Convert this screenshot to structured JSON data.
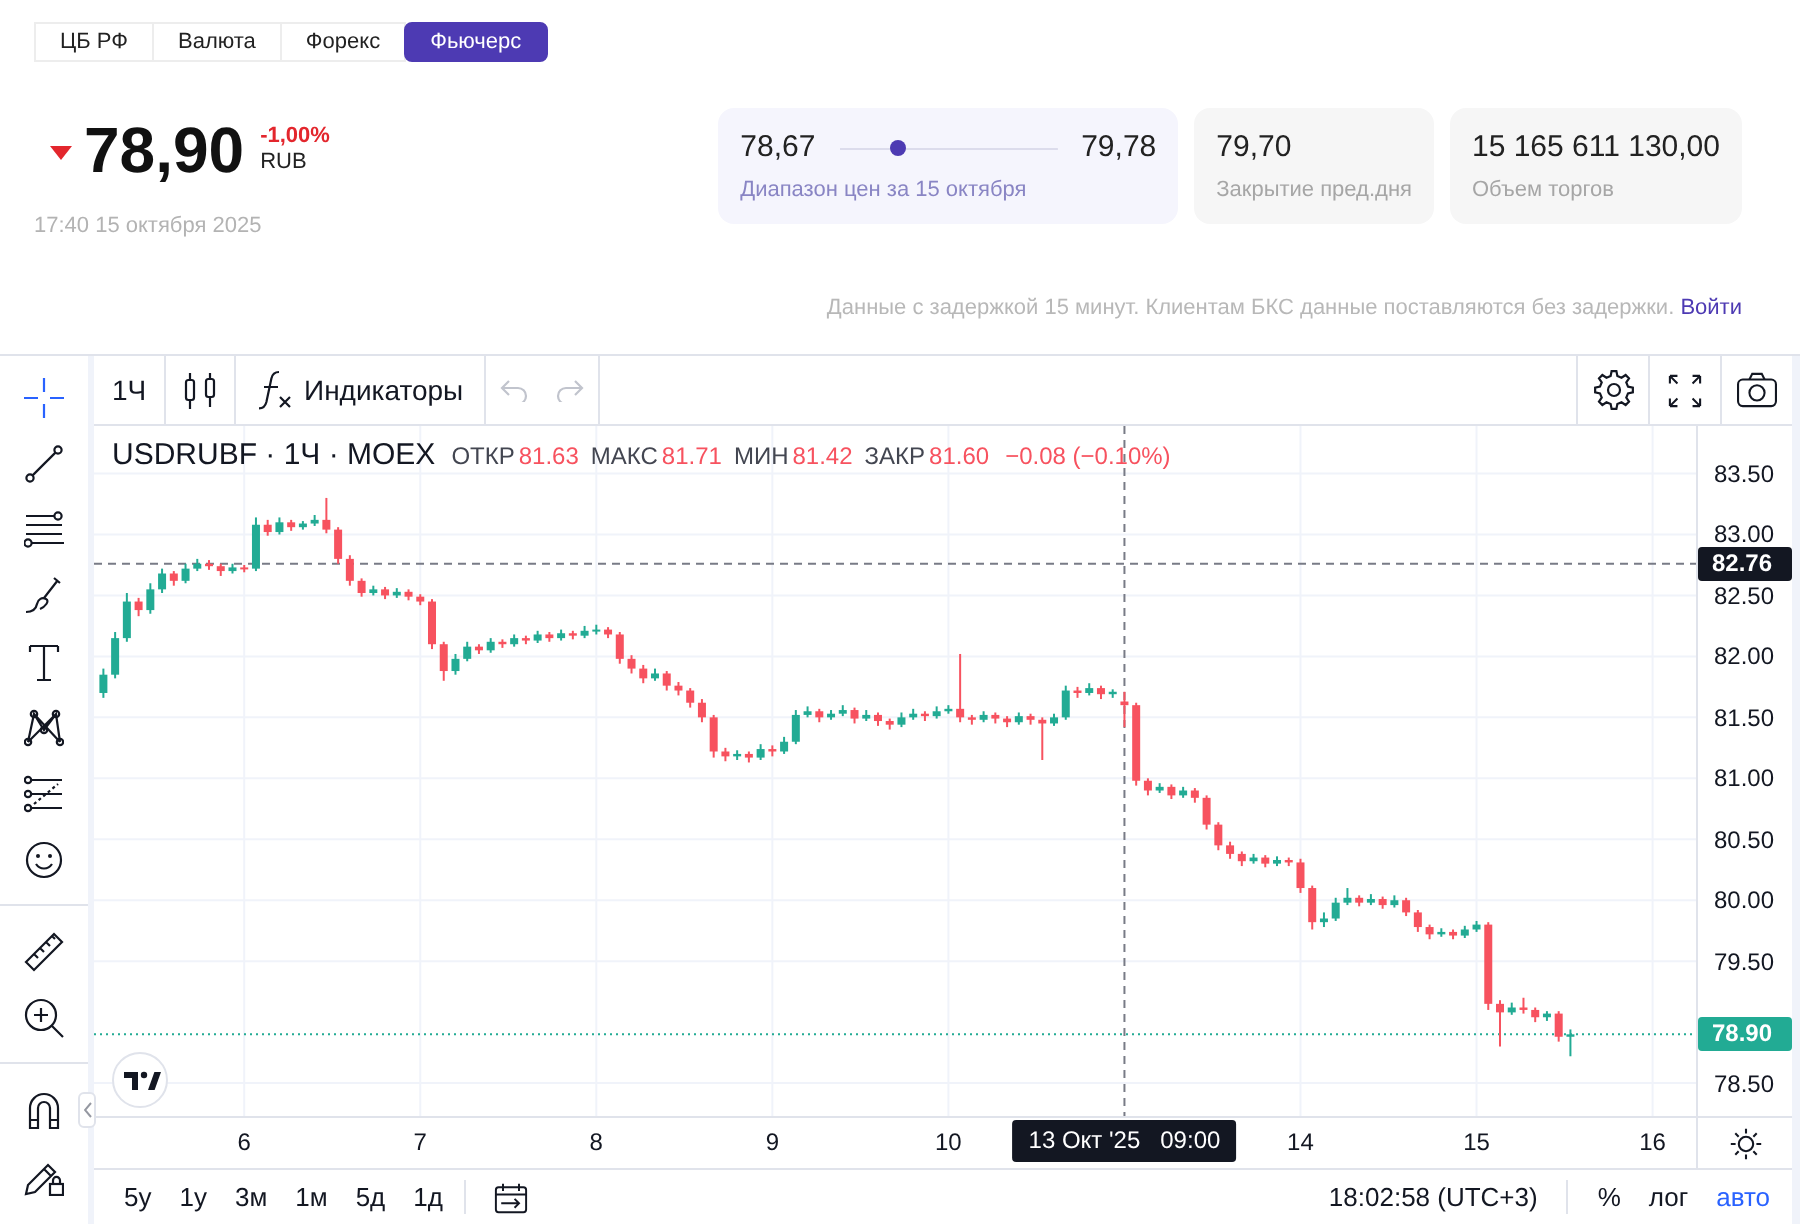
{
  "market_tabs": [
    {
      "label": "ЦБ РФ",
      "selected": false
    },
    {
      "label": "Валюта",
      "selected": false
    },
    {
      "label": "Форекс",
      "selected": false
    },
    {
      "label": "Фьючерс",
      "selected": true
    }
  ],
  "quote": {
    "falling": true,
    "price": "78,90",
    "change": "-1,00%",
    "currency": "RUB",
    "timestamp": "17:40 15 октября 2025"
  },
  "stats": [
    {
      "kind": "range",
      "low": "78,67",
      "high": "79,78",
      "level": 0.25,
      "label": "Диапазон цен за 15 октября"
    },
    {
      "kind": "value",
      "value": "79,70",
      "label": "Закрытие пред.дня"
    },
    {
      "kind": "value",
      "value": "15 165 611 130,00",
      "label": "Объем торгов"
    }
  ],
  "notice": {
    "text": "Данные с задержкой 15 минут. Клиентам БКС данные поставляются без задержки.",
    "link": "Войти"
  },
  "chart": {
    "drawing_tools": [
      {
        "tools": [
          {
            "kind": "crosshair",
            "selected": true
          },
          {
            "kind": "trend_line",
            "selected": false
          },
          {
            "kind": "parallel_lines",
            "selected": false
          },
          {
            "kind": "brush",
            "selected": false
          },
          {
            "kind": "text",
            "selected": false
          },
          {
            "kind": "pattern",
            "selected": false
          },
          {
            "kind": "projection",
            "selected": false
          },
          {
            "kind": "emoji",
            "selected": false
          }
        ]
      },
      {
        "tools": [
          {
            "kind": "ruler",
            "selected": false
          },
          {
            "kind": "zoom",
            "selected": false
          }
        ]
      },
      {
        "tools": [
          {
            "kind": "magnet",
            "selected": false
          },
          {
            "kind": "lock",
            "selected": false
          }
        ]
      }
    ],
    "toolbar": {
      "interval": "1Ч",
      "indicators": "Индикаторы",
      "undo": {
        "disabled": true
      },
      "redo": {
        "disabled": true
      }
    },
    "legend": {
      "title": "USDRUBF · 1Ч · MOEX",
      "falling": true,
      "fields": [
        {
          "label": "ОТКР",
          "value": "81.63"
        },
        {
          "label": "МАКС",
          "value": "81.71"
        },
        {
          "label": "МИН",
          "value": "81.42"
        },
        {
          "label": "ЗАКР",
          "value": "81.60"
        }
      ],
      "change": "−0.08 (−0.10%)"
    },
    "chart_data": {
      "type": "candlestick",
      "grid": true,
      "categories": [
        null,
        null,
        null,
        null,
        null,
        null,
        null,
        null,
        null,
        null,
        null,
        null,
        "6",
        null,
        null,
        null,
        null,
        null,
        null,
        null,
        null,
        null,
        null,
        null,
        null,
        null,
        null,
        "7",
        null,
        null,
        null,
        null,
        null,
        null,
        null,
        null,
        null,
        null,
        null,
        null,
        null,
        null,
        "8",
        null,
        null,
        null,
        null,
        null,
        null,
        null,
        null,
        null,
        null,
        null,
        null,
        null,
        null,
        "9",
        null,
        null,
        null,
        null,
        null,
        null,
        null,
        null,
        null,
        null,
        null,
        null,
        null,
        null,
        "10",
        null,
        null,
        null,
        null,
        null,
        null,
        null,
        null,
        null,
        null,
        null,
        null,
        null,
        null,
        "13 Окт '25   09:00",
        null,
        null,
        null,
        null,
        null,
        null,
        null,
        null,
        null,
        null,
        null,
        null,
        null,
        null,
        "14",
        null,
        null,
        null,
        null,
        null,
        null,
        null,
        null,
        null,
        null,
        null,
        null,
        null,
        null,
        "15",
        null,
        null,
        null,
        null,
        null,
        null,
        null,
        null,
        null,
        null,
        null,
        null,
        null,
        null,
        "16"
      ],
      "ohlc": [
        [
          81.7,
          81.9,
          81.66,
          81.85
        ],
        [
          81.85,
          82.2,
          81.82,
          82.15
        ],
        [
          82.15,
          82.52,
          82.12,
          82.45
        ],
        [
          82.45,
          82.48,
          82.33,
          82.38
        ],
        [
          82.38,
          82.6,
          82.35,
          82.55
        ],
        [
          82.55,
          82.72,
          82.52,
          82.68
        ],
        [
          82.68,
          82.7,
          82.58,
          82.62
        ],
        [
          82.62,
          82.76,
          82.6,
          82.72
        ],
        [
          82.72,
          82.8,
          82.7,
          82.76
        ],
        [
          82.76,
          82.79,
          82.71,
          82.74
        ],
        [
          82.74,
          82.76,
          82.66,
          82.7
        ],
        [
          82.7,
          82.76,
          82.68,
          82.73
        ],
        [
          82.73,
          82.75,
          82.69,
          82.72
        ],
        [
          82.72,
          83.14,
          82.7,
          83.08
        ],
        [
          83.08,
          83.12,
          82.99,
          83.02
        ],
        [
          83.02,
          83.14,
          83.0,
          83.1
        ],
        [
          83.1,
          83.12,
          83.03,
          83.06
        ],
        [
          83.06,
          83.11,
          83.04,
          83.09
        ],
        [
          83.09,
          83.16,
          83.07,
          83.12
        ],
        [
          83.12,
          83.3,
          83.01,
          83.04
        ],
        [
          83.04,
          83.06,
          82.76,
          82.8
        ],
        [
          82.8,
          82.83,
          82.58,
          82.62
        ],
        [
          82.62,
          82.64,
          82.49,
          82.52
        ],
        [
          82.52,
          82.58,
          82.5,
          82.55
        ],
        [
          82.55,
          82.57,
          82.47,
          82.5
        ],
        [
          82.5,
          82.56,
          82.48,
          82.53
        ],
        [
          82.53,
          82.55,
          82.46,
          82.49
        ],
        [
          82.49,
          82.51,
          82.42,
          82.45
        ],
        [
          82.45,
          82.47,
          82.06,
          82.1
        ],
        [
          82.1,
          82.12,
          81.8,
          81.88
        ],
        [
          81.88,
          82.02,
          81.85,
          81.98
        ],
        [
          81.98,
          82.12,
          81.96,
          82.08
        ],
        [
          82.08,
          82.1,
          82.02,
          82.05
        ],
        [
          82.05,
          82.15,
          82.03,
          82.12
        ],
        [
          82.12,
          82.14,
          82.07,
          82.1
        ],
        [
          82.1,
          82.18,
          82.08,
          82.15
        ],
        [
          82.15,
          82.17,
          82.1,
          82.13
        ],
        [
          82.13,
          82.21,
          82.11,
          82.18
        ],
        [
          82.18,
          82.2,
          82.12,
          82.15
        ],
        [
          82.15,
          82.22,
          82.13,
          82.19
        ],
        [
          82.19,
          82.21,
          82.14,
          82.17
        ],
        [
          82.17,
          82.25,
          82.15,
          82.21
        ],
        [
          82.21,
          82.26,
          82.18,
          82.22
        ],
        [
          82.22,
          82.24,
          82.15,
          82.18
        ],
        [
          82.18,
          82.2,
          81.94,
          81.98
        ],
        [
          81.98,
          82.01,
          81.86,
          81.9
        ],
        [
          81.9,
          81.93,
          81.78,
          81.82
        ],
        [
          81.82,
          81.9,
          81.8,
          81.86
        ],
        [
          81.86,
          81.88,
          81.72,
          81.76
        ],
        [
          81.76,
          81.79,
          81.68,
          81.72
        ],
        [
          81.72,
          81.74,
          81.58,
          81.62
        ],
        [
          81.62,
          81.65,
          81.46,
          81.5
        ],
        [
          81.5,
          81.52,
          81.17,
          81.22
        ],
        [
          81.22,
          81.25,
          81.14,
          81.18
        ],
        [
          81.18,
          81.23,
          81.15,
          81.2
        ],
        [
          81.2,
          81.22,
          81.13,
          81.17
        ],
        [
          81.17,
          81.28,
          81.15,
          81.24
        ],
        [
          81.24,
          81.27,
          81.18,
          81.22
        ],
        [
          81.22,
          81.34,
          81.2,
          81.3
        ],
        [
          81.3,
          81.56,
          81.28,
          81.52
        ],
        [
          81.52,
          81.59,
          81.5,
          81.55
        ],
        [
          81.55,
          81.57,
          81.46,
          81.5
        ],
        [
          81.5,
          81.56,
          81.48,
          81.53
        ],
        [
          81.53,
          81.6,
          81.51,
          81.56
        ],
        [
          81.56,
          81.58,
          81.45,
          81.49
        ],
        [
          81.49,
          81.56,
          81.47,
          81.52
        ],
        [
          81.52,
          81.54,
          81.43,
          81.47
        ],
        [
          81.47,
          81.49,
          81.4,
          81.44
        ],
        [
          81.44,
          81.54,
          81.42,
          81.5
        ],
        [
          81.5,
          81.57,
          81.48,
          81.53
        ],
        [
          81.53,
          81.55,
          81.47,
          81.51
        ],
        [
          81.51,
          81.59,
          81.49,
          81.55
        ],
        [
          81.55,
          81.6,
          81.53,
          81.57
        ],
        [
          81.57,
          82.02,
          81.46,
          81.5
        ],
        [
          81.5,
          81.52,
          81.44,
          81.48
        ],
        [
          81.48,
          81.55,
          81.46,
          81.52
        ],
        [
          81.52,
          81.54,
          81.45,
          81.49
        ],
        [
          81.49,
          81.51,
          81.42,
          81.46
        ],
        [
          81.46,
          81.54,
          81.44,
          81.51
        ],
        [
          81.51,
          81.53,
          81.44,
          81.48
        ],
        [
          81.48,
          81.5,
          81.15,
          81.45
        ],
        [
          81.45,
          81.53,
          81.43,
          81.5
        ],
        [
          81.5,
          81.76,
          81.48,
          81.72
        ],
        [
          81.72,
          81.75,
          81.66,
          81.7
        ],
        [
          81.7,
          81.78,
          81.68,
          81.74
        ],
        [
          81.74,
          81.76,
          81.65,
          81.69
        ],
        [
          81.69,
          81.73,
          81.66,
          81.71
        ],
        [
          81.63,
          81.71,
          81.42,
          81.6
        ],
        [
          81.6,
          81.62,
          80.94,
          80.98
        ],
        [
          80.98,
          81.0,
          80.86,
          80.9
        ],
        [
          80.9,
          80.96,
          80.88,
          80.93
        ],
        [
          80.93,
          80.95,
          80.83,
          80.86
        ],
        [
          80.86,
          80.93,
          80.84,
          80.9
        ],
        [
          80.9,
          80.92,
          80.8,
          80.84
        ],
        [
          80.84,
          80.86,
          80.58,
          80.62
        ],
        [
          80.62,
          80.64,
          80.41,
          80.45
        ],
        [
          80.45,
          80.48,
          80.34,
          80.38
        ],
        [
          80.38,
          80.4,
          80.28,
          80.32
        ],
        [
          80.32,
          80.38,
          80.3,
          80.35
        ],
        [
          80.35,
          80.37,
          80.27,
          80.3
        ],
        [
          80.3,
          80.36,
          80.28,
          80.33
        ],
        [
          80.33,
          80.35,
          80.28,
          80.31
        ],
        [
          80.31,
          80.34,
          80.06,
          80.1
        ],
        [
          80.1,
          80.12,
          79.76,
          79.82
        ],
        [
          79.82,
          79.9,
          79.78,
          79.85
        ],
        [
          79.85,
          80.02,
          79.83,
          79.98
        ],
        [
          79.98,
          80.1,
          79.96,
          80.02
        ],
        [
          80.02,
          80.04,
          79.95,
          79.98
        ],
        [
          79.98,
          80.05,
          79.96,
          80.01
        ],
        [
          80.01,
          80.03,
          79.93,
          79.96
        ],
        [
          79.96,
          80.04,
          79.94,
          80.0
        ],
        [
          80.0,
          80.02,
          79.87,
          79.9
        ],
        [
          79.9,
          79.92,
          79.74,
          79.78
        ],
        [
          79.78,
          79.8,
          79.68,
          79.72
        ],
        [
          79.72,
          79.77,
          79.7,
          79.74
        ],
        [
          79.74,
          79.76,
          79.68,
          79.71
        ],
        [
          79.71,
          79.79,
          79.69,
          79.76
        ],
        [
          79.76,
          79.83,
          79.74,
          79.8
        ],
        [
          79.8,
          79.82,
          79.1,
          79.15
        ],
        [
          79.15,
          79.18,
          78.8,
          79.08
        ],
        [
          79.08,
          79.16,
          79.06,
          79.12
        ],
        [
          79.12,
          79.2,
          79.07,
          79.1
        ],
        [
          79.1,
          79.12,
          79.0,
          79.04
        ],
        [
          79.04,
          79.09,
          79.01,
          79.07
        ],
        [
          79.07,
          79.09,
          78.84,
          78.88
        ],
        [
          78.88,
          78.94,
          78.72,
          78.9
        ],
        null,
        null,
        null,
        null,
        null,
        null,
        null
      ],
      "ylim": [
        78.23,
        83.89
      ],
      "yticks": [
        {
          "value": 83.5,
          "label": "83.50"
        },
        {
          "value": 83,
          "label": "83.00"
        },
        {
          "value": 82.5,
          "label": "82.50"
        },
        {
          "value": 82,
          "label": "82.00"
        },
        {
          "value": 81.5,
          "label": "81.50"
        },
        {
          "value": 81,
          "label": "81.00"
        },
        {
          "value": 80.5,
          "label": "80.50"
        },
        {
          "value": 80,
          "label": "80.00"
        },
        {
          "value": 79.5,
          "label": "79.50"
        },
        {
          "value": 78.5,
          "label": "78.50"
        }
      ],
      "ref_lines": [
        {
          "axis": "x",
          "value": "13 Окт '25   09:00",
          "color": "#787b86"
        },
        {
          "axis": "y",
          "value": 82.76,
          "label": "82.76",
          "color": "#787b86"
        },
        {
          "axis": "y",
          "value": 78.9,
          "label": "78.90",
          "color": "#22ab94"
        }
      ]
    },
    "ranges": [
      "5у",
      "1у",
      "3м",
      "1м",
      "5д",
      "1д"
    ],
    "clock": "18:02:58 (UTC+3)",
    "scale_options": [
      {
        "label": "%",
        "selected": false
      },
      {
        "label": "лог",
        "selected": false
      },
      {
        "label": "авто",
        "selected": true
      }
    ]
  }
}
